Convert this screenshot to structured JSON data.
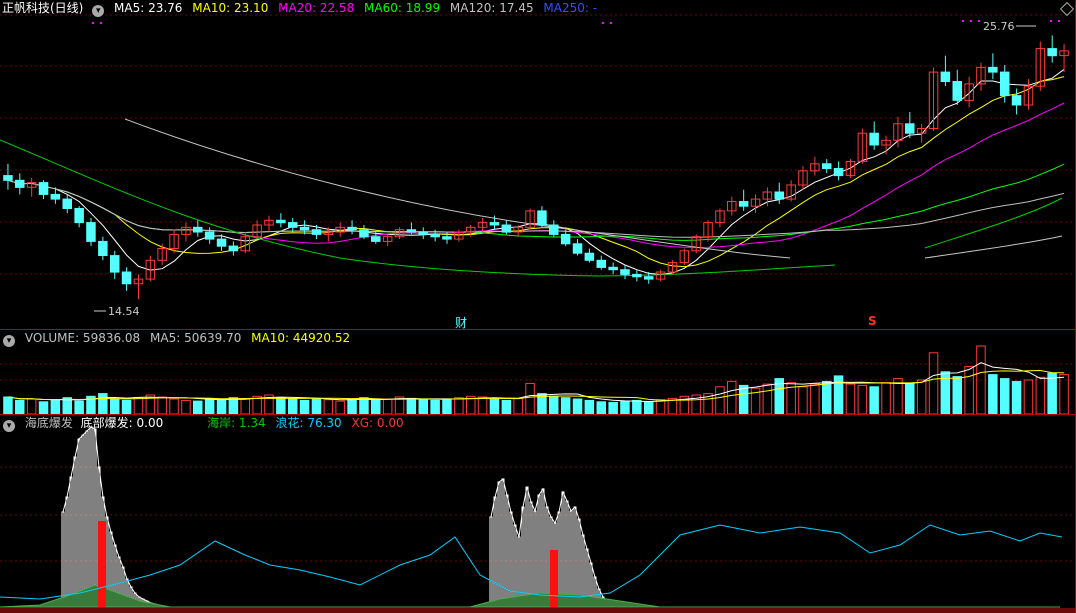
{
  "main": {
    "title": "正帆科技(日线)",
    "ma": [
      {
        "label": "MA5: 23.76",
        "color": "#ffffff"
      },
      {
        "label": "MA10: 23.10",
        "color": "#ffff00"
      },
      {
        "label": "MA20: 22.58",
        "color": "#ff00ff"
      },
      {
        "label": "MA60: 18.99",
        "color": "#00ff00"
      },
      {
        "label": "MA120: 17.45",
        "color": "#c0c0c0"
      },
      {
        "label": "MA250: -",
        "color": "#3050ff"
      }
    ],
    "high_label": "25.76",
    "low_label": "14.54",
    "marker_cai": "财",
    "marker_s": "S"
  },
  "volume": {
    "labels": [
      {
        "label": "VOLUME: 59836.08",
        "color": "#c0c0c0"
      },
      {
        "label": "MA5: 50639.70",
        "color": "#c0c0c0"
      },
      {
        "label": "MA10: 44920.52",
        "color": "#ffff00"
      }
    ]
  },
  "indicator": {
    "labels": [
      {
        "label": "海底爆发",
        "color": "#c0c0c0"
      },
      {
        "label": "底部爆发: 0.00",
        "color": "#ffffff"
      },
      {
        "label": "海岸: 1.34",
        "color": "#00cc00"
      },
      {
        "label": "浪花: 76.30",
        "color": "#00d0ff"
      },
      {
        "label": "XG: 0.00",
        "color": "#ff3030"
      }
    ]
  },
  "chart_data": [
    {
      "type": "candlestick",
      "title": "正帆科技(日线)",
      "ylim": [
        14.0,
        26.5
      ],
      "high": 25.76,
      "low": 14.54,
      "series_colors": {
        "up": "#ff3a3a",
        "down": "#54ffff"
      },
      "candles": [
        [
          19.8,
          20.3,
          19.2,
          19.6
        ],
        [
          19.6,
          19.9,
          19.0,
          19.3
        ],
        [
          19.3,
          19.7,
          18.9,
          19.5
        ],
        [
          19.5,
          19.6,
          18.8,
          19.0
        ],
        [
          19.0,
          19.3,
          18.6,
          18.8
        ],
        [
          18.8,
          19.0,
          18.2,
          18.4
        ],
        [
          18.4,
          18.5,
          17.6,
          17.8
        ],
        [
          17.8,
          18.0,
          16.8,
          17.0
        ],
        [
          17.0,
          17.2,
          16.2,
          16.4
        ],
        [
          16.4,
          16.6,
          15.4,
          15.7
        ],
        [
          15.7,
          15.9,
          14.9,
          15.2
        ],
        [
          15.2,
          15.6,
          14.54,
          15.4
        ],
        [
          15.4,
          16.4,
          15.3,
          16.2
        ],
        [
          16.2,
          16.9,
          16.0,
          16.7
        ],
        [
          16.7,
          17.5,
          16.5,
          17.3
        ],
        [
          17.3,
          17.8,
          17.0,
          17.6
        ],
        [
          17.6,
          17.9,
          17.2,
          17.4
        ],
        [
          17.4,
          17.6,
          16.9,
          17.1
        ],
        [
          17.1,
          17.3,
          16.6,
          16.8
        ],
        [
          16.8,
          17.0,
          16.4,
          16.6
        ],
        [
          16.6,
          17.4,
          16.5,
          17.2
        ],
        [
          17.2,
          17.9,
          17.1,
          17.7
        ],
        [
          17.7,
          18.1,
          17.4,
          17.9
        ],
        [
          17.9,
          18.2,
          17.6,
          17.8
        ],
        [
          17.8,
          18.0,
          17.4,
          17.6
        ],
        [
          17.6,
          17.9,
          17.3,
          17.5
        ],
        [
          17.5,
          17.7,
          17.1,
          17.3
        ],
        [
          17.3,
          17.6,
          17.0,
          17.4
        ],
        [
          17.4,
          17.8,
          17.2,
          17.6
        ],
        [
          17.6,
          17.9,
          17.3,
          17.5
        ],
        [
          17.5,
          17.7,
          17.1,
          17.2
        ],
        [
          17.2,
          17.4,
          16.9,
          17.0
        ],
        [
          17.0,
          17.3,
          16.8,
          17.2
        ],
        [
          17.2,
          17.6,
          17.1,
          17.5
        ],
        [
          17.5,
          17.8,
          17.3,
          17.4
        ],
        [
          17.4,
          17.6,
          17.1,
          17.3
        ],
        [
          17.3,
          17.5,
          17.0,
          17.2
        ],
        [
          17.2,
          17.4,
          16.9,
          17.1
        ],
        [
          17.1,
          17.5,
          17.0,
          17.4
        ],
        [
          17.4,
          17.7,
          17.2,
          17.6
        ],
        [
          17.6,
          18.0,
          17.4,
          17.8
        ],
        [
          17.8,
          18.1,
          17.5,
          17.7
        ],
        [
          17.7,
          17.9,
          17.3,
          17.4
        ],
        [
          17.4,
          17.7,
          17.2,
          17.6
        ],
        [
          17.6,
          18.4,
          17.5,
          18.3
        ],
        [
          18.3,
          18.5,
          17.6,
          17.7
        ],
        [
          17.7,
          17.9,
          17.2,
          17.3
        ],
        [
          17.3,
          17.5,
          16.8,
          16.9
        ],
        [
          16.9,
          17.1,
          16.4,
          16.5
        ],
        [
          16.5,
          16.7,
          16.1,
          16.2
        ],
        [
          16.2,
          16.4,
          15.8,
          15.9
        ],
        [
          15.9,
          16.1,
          15.6,
          15.8
        ],
        [
          15.8,
          16.0,
          15.4,
          15.6
        ],
        [
          15.6,
          15.8,
          15.3,
          15.5
        ],
        [
          15.5,
          15.7,
          15.2,
          15.4
        ],
        [
          15.4,
          15.8,
          15.3,
          15.7
        ],
        [
          15.7,
          16.2,
          15.6,
          16.1
        ],
        [
          16.1,
          16.7,
          16.0,
          16.6
        ],
        [
          16.6,
          17.3,
          16.5,
          17.2
        ],
        [
          17.2,
          17.9,
          17.0,
          17.8
        ],
        [
          17.8,
          18.4,
          17.6,
          18.3
        ],
        [
          18.3,
          18.9,
          18.1,
          18.7
        ],
        [
          18.7,
          19.2,
          18.3,
          18.5
        ],
        [
          18.5,
          19.0,
          18.2,
          18.8
        ],
        [
          18.8,
          19.3,
          18.5,
          19.1
        ],
        [
          19.1,
          19.5,
          18.6,
          18.8
        ],
        [
          18.8,
          19.6,
          18.7,
          19.4
        ],
        [
          19.4,
          20.2,
          19.2,
          20.0
        ],
        [
          20.0,
          20.6,
          19.8,
          20.3
        ],
        [
          20.3,
          20.5,
          19.9,
          20.1
        ],
        [
          20.1,
          20.4,
          19.6,
          19.8
        ],
        [
          19.8,
          20.5,
          19.7,
          20.4
        ],
        [
          20.4,
          21.8,
          20.3,
          21.6
        ],
        [
          21.6,
          22.1,
          20.9,
          21.1
        ],
        [
          21.1,
          21.5,
          20.7,
          21.3
        ],
        [
          21.3,
          22.3,
          21.0,
          22.0
        ],
        [
          22.0,
          22.5,
          21.4,
          21.6
        ],
        [
          21.6,
          22.0,
          21.2,
          21.8
        ],
        [
          21.8,
          24.4,
          21.7,
          24.2
        ],
        [
          24.2,
          24.9,
          23.6,
          23.8
        ],
        [
          23.8,
          24.3,
          22.8,
          23.0
        ],
        [
          23.0,
          24.0,
          22.7,
          23.7
        ],
        [
          23.7,
          24.6,
          23.4,
          24.4
        ],
        [
          24.4,
          25.0,
          23.9,
          24.2
        ],
        [
          24.2,
          24.5,
          22.9,
          23.2
        ],
        [
          23.2,
          23.5,
          22.4,
          22.8
        ],
        [
          22.8,
          23.9,
          22.6,
          23.6
        ],
        [
          23.6,
          25.5,
          23.4,
          25.2
        ],
        [
          25.2,
          25.76,
          24.6,
          24.9
        ],
        [
          24.9,
          25.4,
          24.2,
          25.1
        ]
      ],
      "ma_lines": [
        {
          "name": "MA5",
          "color": "#ffffff"
        },
        {
          "name": "MA10",
          "color": "#ffff00"
        },
        {
          "name": "MA20",
          "color": "#ff00ff"
        },
        {
          "name": "MA60",
          "color": "#00ff00"
        },
        {
          "name": "MA120",
          "color": "#c0c0c0"
        }
      ]
    },
    {
      "type": "bar",
      "title": "VOLUME",
      "values": [
        25,
        20,
        22,
        18,
        21,
        24,
        19,
        26,
        30,
        22,
        20,
        24,
        28,
        25,
        22,
        20,
        19,
        23,
        21,
        24,
        22,
        26,
        28,
        24,
        22,
        20,
        23,
        21,
        19,
        22,
        24,
        20,
        22,
        25,
        23,
        21,
        20,
        22,
        24,
        26,
        25,
        22,
        20,
        23,
        45,
        30,
        26,
        24,
        22,
        20,
        18,
        17,
        19,
        20,
        18,
        21,
        23,
        26,
        28,
        30,
        40,
        48,
        42,
        38,
        44,
        52,
        46,
        40,
        44,
        48,
        56,
        44,
        42,
        40,
        46,
        52,
        45,
        50,
        90,
        62,
        55,
        70,
        100,
        58,
        52,
        48,
        50,
        54,
        60,
        58
      ]
    },
    {
      "type": "bar",
      "title": "海底爆发",
      "series": [
        {
          "name": "底部爆发",
          "color": "#ffffff"
        },
        {
          "name": "海岸",
          "color": "#00cc00"
        },
        {
          "name": "浪花",
          "color": "#00d0ff"
        },
        {
          "name": "XG",
          "color": "#ff3030"
        }
      ]
    }
  ]
}
